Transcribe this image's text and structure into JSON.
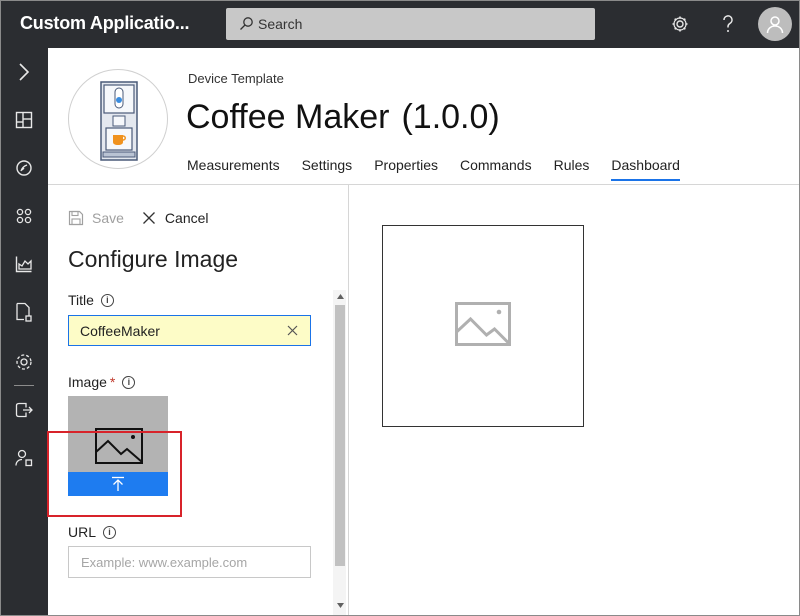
{
  "app": {
    "title": "Custom Applicatio..."
  },
  "search": {
    "label": "Search"
  },
  "topbar": {
    "icons": [
      "gear-icon",
      "help-icon",
      "user-avatar-icon"
    ]
  },
  "nav": {
    "icons": [
      "expand-chevron-icon",
      "dashboard-icon",
      "devices-icon",
      "device-sets-icon",
      "analytics-icon",
      "device-templates-icon",
      "continuous-export-icon",
      "data-export-icon",
      "administration-icon"
    ]
  },
  "device": {
    "type_label": "Device Template",
    "name": "Coffee Maker",
    "version": "(1.0.0)"
  },
  "tabs": [
    {
      "label": "Measurements"
    },
    {
      "label": "Settings"
    },
    {
      "label": "Properties"
    },
    {
      "label": "Commands"
    },
    {
      "label": "Rules"
    },
    {
      "label": "Dashboard"
    }
  ],
  "active_tab": "Dashboard",
  "actions": {
    "save": "Save",
    "cancel": "Cancel"
  },
  "panel": {
    "title": "Configure Image",
    "fields": {
      "title_label": "Title",
      "title_value": "CoffeeMaker",
      "image_label": "Image",
      "image_required_mark": "*",
      "url_label": "URL",
      "url_placeholder": "Example: www.example.com"
    }
  },
  "colors": {
    "accent": "#1a73e8",
    "upload": "#1e7cf0",
    "highlight": "#d8232a",
    "chrome": "#2b2d31",
    "input_bg": "#fdfcc7"
  }
}
